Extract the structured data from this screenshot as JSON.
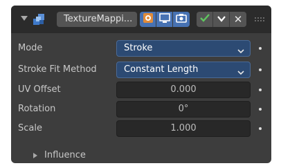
{
  "modifier": {
    "name": "TextureMappi...",
    "icon": "texture-mapping-modifier-icon",
    "header_toggles": [
      "edit-mode-icon",
      "viewport-display-icon",
      "render-icon"
    ],
    "header_actions": [
      "apply-check-icon",
      "dropdown-chevron-icon",
      "close-icon"
    ],
    "delete_label": "✕"
  },
  "fields": {
    "mode": {
      "label": "Mode",
      "value": "Stroke"
    },
    "stroke_fit": {
      "label": "Stroke Fit Method",
      "value": "Constant Length"
    },
    "uv_offset": {
      "label": "UV Offset",
      "value": "0.000"
    },
    "rotation": {
      "label": "Rotation",
      "value": "0°"
    },
    "scale": {
      "label": "Scale",
      "value": "1.000"
    }
  },
  "subpanel": {
    "label": "Influence"
  },
  "colors": {
    "panel_bg": "#3d3d3d",
    "header_bg": "#2b2b2b",
    "dropdown_bg": "#2c4a73",
    "field_bg": "#282828",
    "accent": "#4772b3",
    "check_green": "#5fc75f"
  }
}
